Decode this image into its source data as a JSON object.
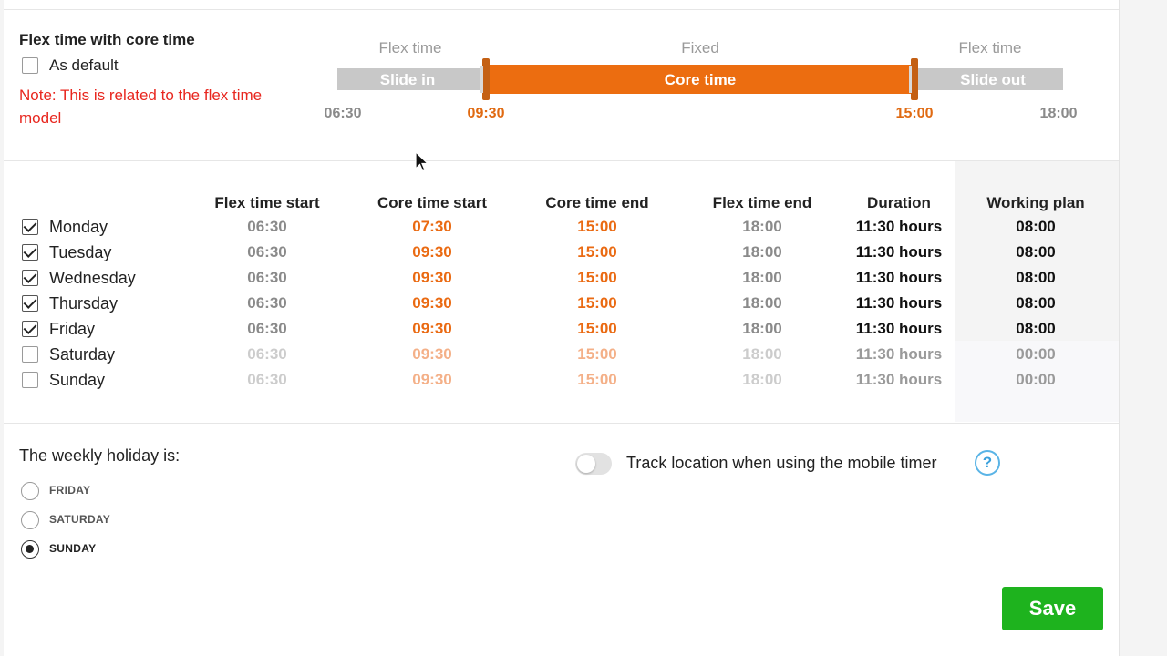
{
  "flex_section": {
    "title": "Flex time with core time",
    "as_default": {
      "label": "As default",
      "checked": false
    },
    "note": "Note: This is related to the flex time model"
  },
  "timeline": {
    "labels": {
      "left": "Flex time",
      "middle": "Fixed",
      "right": "Flex time"
    },
    "segments": {
      "slide_in": "Slide in",
      "core": "Core time",
      "slide_out": "Slide out"
    },
    "times": {
      "flex_start": "06:30",
      "core_start": "09:30",
      "core_end": "15:00",
      "flex_end": "18:00"
    },
    "colors": {
      "core": "#ec6d10",
      "flex": "#c8c8c8"
    }
  },
  "table": {
    "headers": {
      "flex_start": "Flex time start",
      "core_start": "Core time start",
      "core_end": "Core time end",
      "flex_end": "Flex time end",
      "duration": "Duration",
      "working_plan": "Working plan"
    },
    "rows": [
      {
        "day": "Monday",
        "checked": true,
        "flex_start": "06:30",
        "core_start": "07:30",
        "core_end": "15:00",
        "flex_end": "18:00",
        "duration": "11:30 hours",
        "working_plan": "08:00"
      },
      {
        "day": "Tuesday",
        "checked": true,
        "flex_start": "06:30",
        "core_start": "09:30",
        "core_end": "15:00",
        "flex_end": "18:00",
        "duration": "11:30 hours",
        "working_plan": "08:00"
      },
      {
        "day": "Wednesday",
        "checked": true,
        "flex_start": "06:30",
        "core_start": "09:30",
        "core_end": "15:00",
        "flex_end": "18:00",
        "duration": "11:30 hours",
        "working_plan": "08:00"
      },
      {
        "day": "Thursday",
        "checked": true,
        "flex_start": "06:30",
        "core_start": "09:30",
        "core_end": "15:00",
        "flex_end": "18:00",
        "duration": "11:30 hours",
        "working_plan": "08:00"
      },
      {
        "day": "Friday",
        "checked": true,
        "flex_start": "06:30",
        "core_start": "09:30",
        "core_end": "15:00",
        "flex_end": "18:00",
        "duration": "11:30 hours",
        "working_plan": "08:00"
      },
      {
        "day": "Saturday",
        "checked": false,
        "flex_start": "06:30",
        "core_start": "09:30",
        "core_end": "15:00",
        "flex_end": "18:00",
        "duration": "11:30 hours",
        "working_plan": "00:00"
      },
      {
        "day": "Sunday",
        "checked": false,
        "flex_start": "06:30",
        "core_start": "09:30",
        "core_end": "15:00",
        "flex_end": "18:00",
        "duration": "11:30 hours",
        "working_plan": "00:00"
      }
    ]
  },
  "weekly_holiday": {
    "title": "The weekly holiday is:",
    "options": [
      {
        "label": "FRIDAY",
        "selected": false
      },
      {
        "label": "SATURDAY",
        "selected": false
      },
      {
        "label": "SUNDAY",
        "selected": true
      }
    ]
  },
  "track_location": {
    "label": "Track location when using the mobile timer",
    "enabled": false,
    "help_icon": "help-icon",
    "help_glyph": "?"
  },
  "save_label": "Save",
  "colors": {
    "accent_orange": "#ec6d10",
    "save_green": "#1eb31e",
    "note_red": "#e8271f",
    "help_blue": "#3aa0dc"
  }
}
